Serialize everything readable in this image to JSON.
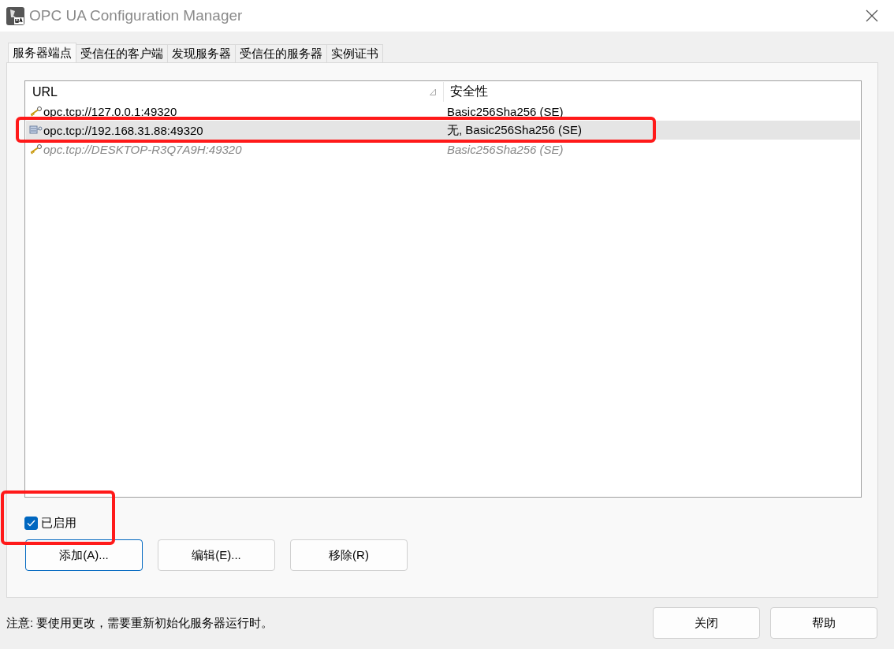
{
  "window": {
    "title": "OPC UA Configuration Manager"
  },
  "tabs": [
    {
      "label": "服务器端点",
      "selected": true
    },
    {
      "label": "受信任的客户端",
      "selected": false
    },
    {
      "label": "发现服务器",
      "selected": false
    },
    {
      "label": "受信任的服务器",
      "selected": false
    },
    {
      "label": "实例证书",
      "selected": false
    }
  ],
  "table": {
    "columns": [
      "URL",
      "安全性"
    ],
    "rows": [
      {
        "url": "opc.tcp://127.0.0.1:49320",
        "security": "Basic256Sha256 (SE)",
        "kind": "key",
        "selected": false,
        "disabled": false,
        "highlighted": false
      },
      {
        "url": "opc.tcp://192.168.31.88:49320",
        "security": "无, Basic256Sha256 (SE)",
        "kind": "network",
        "selected": true,
        "disabled": false,
        "highlighted": true
      },
      {
        "url": "opc.tcp://DESKTOP-R3Q7A9H:49320",
        "security": "Basic256Sha256 (SE)",
        "kind": "key",
        "selected": false,
        "disabled": true,
        "highlighted": false
      }
    ]
  },
  "enabled": {
    "label": "已启用",
    "checked": true,
    "highlighted": true
  },
  "buttons": [
    {
      "label": "添加(A)...",
      "focused": true
    },
    {
      "label": "编辑(E)...",
      "focused": false
    },
    {
      "label": "移除(R)",
      "focused": false
    }
  ],
  "note": "注意: 要使用更改，需要重新初始化服务器运行时。",
  "footer_buttons": [
    "关闭",
    "帮助"
  ]
}
